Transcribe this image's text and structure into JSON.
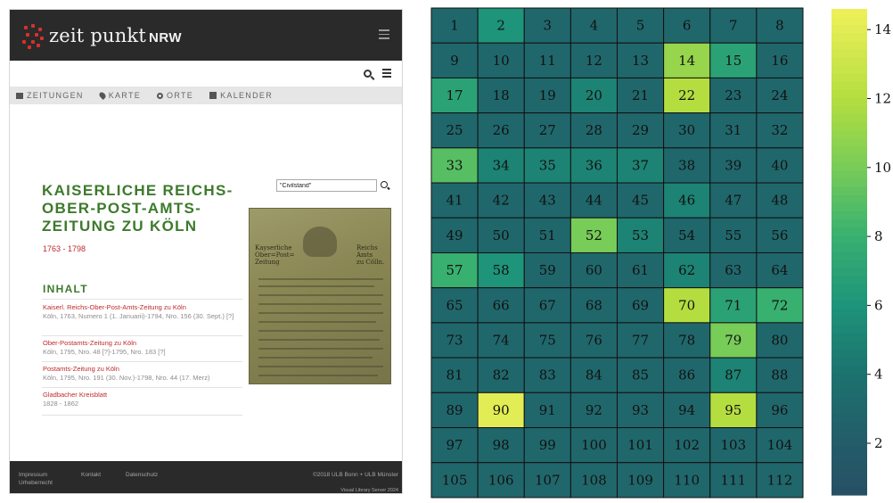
{
  "site": {
    "logo": {
      "text": "zeit punkt",
      "suffix": "NRW"
    },
    "nav": [
      {
        "label": "ZEITUNGEN",
        "icon": "newspaper-icon"
      },
      {
        "label": "KARTE",
        "icon": "map-pin-icon"
      },
      {
        "label": "ORTE",
        "icon": "location-icon"
      },
      {
        "label": "KALENDER",
        "icon": "calendar-icon"
      }
    ],
    "title": "KAISERLICHE REICHS-OBER-POST-AMTS-ZEITUNG ZU KÖLN",
    "years": "1763 - 1798",
    "search": {
      "value": "\"Civilstand\""
    },
    "inhalt": {
      "heading": "INHALT",
      "entries": [
        {
          "title": "Kaiserl. Reichs-Ober-Post-Amts-Zeitung zu Köln",
          "sub": "Köln, 1763, Numero 1 (1. Januarii)-1794, Nro. 156 (30. Sept.) [?]"
        },
        {
          "title": "Ober-Postamts-Zeitung zu Köln",
          "sub": "Köln, 1795, Nro. 48 [?]-1795, Nro. 183 [?]"
        },
        {
          "title": "Postamts-Zeitung zu Köln",
          "sub": "Köln, 1795, Nro. 191 (30. Nov.)-1798, Nro. 44 (17. Merz)"
        },
        {
          "title": "Gladbacher Kreisblatt",
          "sub": "1828 - 1862"
        }
      ]
    },
    "footer": {
      "links": [
        "Impressum",
        "Kontakt",
        "Datenschutz"
      ],
      "rights": "Urheberrecht",
      "copyright": "©2018 ULB Bonn + ULB Münster",
      "server": "Visual Library Server 2024"
    },
    "colors": {
      "green": "#3d7a2c",
      "red": "#c0292a",
      "dark": "#2a2a2a"
    }
  },
  "chart_data": {
    "type": "heatmap",
    "rows": 14,
    "cols": 8,
    "cell_labels": "1 to 112, row-major",
    "values": [
      [
        3,
        6,
        3,
        3,
        3,
        3,
        3,
        3
      ],
      [
        3,
        3,
        3,
        3,
        3,
        11,
        7,
        3
      ],
      [
        7,
        3,
        3,
        5,
        3,
        12,
        3,
        3
      ],
      [
        3,
        3,
        3,
        3,
        3,
        3,
        3,
        3
      ],
      [
        9,
        5,
        5,
        5,
        5,
        3,
        3,
        3
      ],
      [
        3,
        3,
        3,
        3,
        3,
        5,
        3,
        3
      ],
      [
        3,
        3,
        3,
        10,
        5,
        3,
        3,
        3
      ],
      [
        8,
        6,
        3,
        3,
        3,
        5,
        3,
        3
      ],
      [
        3,
        3,
        3,
        3,
        3,
        12,
        7,
        8
      ],
      [
        3,
        3,
        3,
        3,
        3,
        3,
        10,
        3
      ],
      [
        3,
        3,
        3,
        3,
        3,
        3,
        5,
        3
      ],
      [
        3,
        14,
        3,
        3,
        3,
        3,
        12,
        3
      ],
      [
        3,
        3,
        3,
        3,
        3,
        3,
        3,
        3
      ],
      [
        3,
        3,
        3,
        3,
        3,
        3,
        3,
        3
      ]
    ],
    "colorbar": {
      "ticks": [
        2,
        4,
        6,
        8,
        10,
        12,
        14
      ],
      "range": [
        0.5,
        14.6
      ],
      "colormap": "viridis (upper range)"
    }
  }
}
